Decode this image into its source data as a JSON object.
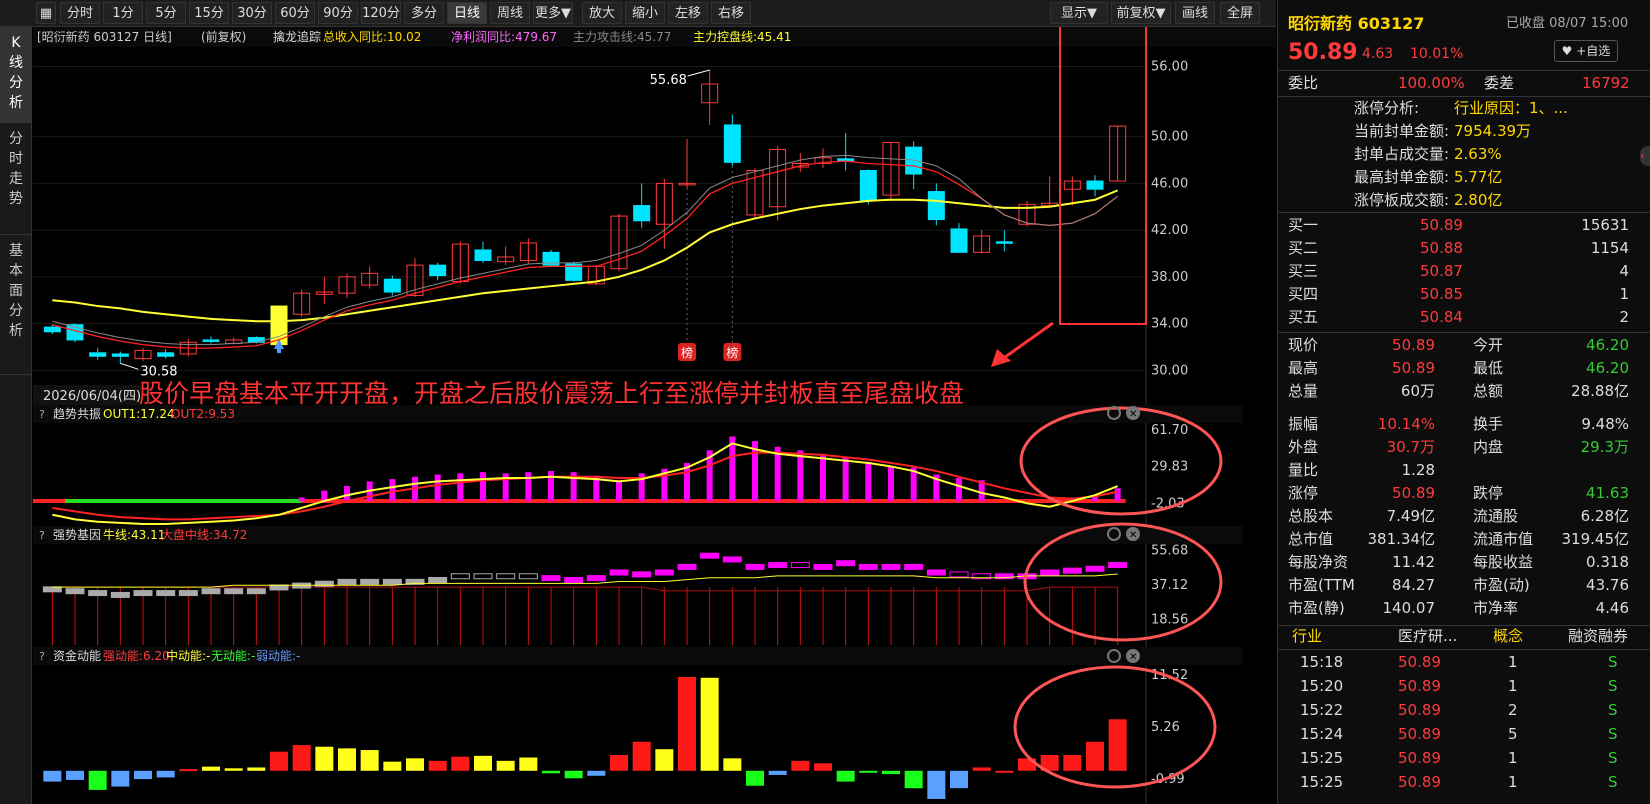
{
  "toolbar": {
    "periods": [
      "分时",
      "1分",
      "5分",
      "15分",
      "30分",
      "60分",
      "90分",
      "120分",
      "多分钟",
      "日线",
      "周线",
      "更多▼"
    ],
    "active_period": "日线",
    "tools": [
      "放大",
      "缩小",
      "左移",
      "右移"
    ],
    "right_tools": [
      "显示▼",
      "前复权▼",
      "画线",
      "全屏"
    ]
  },
  "left_tabs": [
    {
      "label": [
        "K",
        "线",
        "分",
        "析"
      ],
      "active": true
    },
    {
      "label": [
        "分",
        "时",
        "走",
        "势"
      ],
      "active": false
    },
    {
      "label": [
        "基",
        "本",
        "面",
        "分",
        "析"
      ],
      "active": false
    }
  ],
  "main_chart": {
    "header_stock": "[昭衍新药 603127 日线]",
    "header_fq": "(前复权)",
    "indicator_name": "擒龙追踪",
    "ind1": "总收入同比:10.02",
    "ind2": "净利润同比:479.67",
    "ind3": "主力攻击线:45.77",
    "ind4": "主力控盘线:45.41",
    "date_label": "2026/06/04(四)",
    "high_marker": "55.68",
    "low_marker": "30.58",
    "bang_label": "榜",
    "annotation": "股价早盘基本平开开盘，开盘之后股价震荡上行至涨停并封板直至尾盘收盘",
    "hidden_char": "尾",
    "sub_char": "开"
  },
  "chart_data": [
    {
      "type": "candlestick",
      "title": "",
      "y_ticks": [
        "56.00",
        "50.00",
        "46.00",
        "42.00",
        "38.00",
        "34.00",
        "30.00"
      ],
      "ylim": [
        30,
        58
      ],
      "candles": [
        {
          "o": 33.7,
          "c": 33.3,
          "h": 33.9,
          "l": 33.1
        },
        {
          "o": 33.9,
          "c": 32.6,
          "h": 34.0,
          "l": 32.4
        },
        {
          "o": 31.5,
          "c": 31.2,
          "h": 31.9,
          "l": 30.9
        },
        {
          "o": 31.4,
          "c": 31.2,
          "h": 31.6,
          "l": 30.6
        },
        {
          "o": 31.0,
          "c": 31.7,
          "h": 31.9,
          "l": 30.8
        },
        {
          "o": 31.5,
          "c": 31.2,
          "h": 31.8,
          "l": 31.0
        },
        {
          "o": 31.4,
          "c": 32.4,
          "h": 32.7,
          "l": 31.2
        },
        {
          "o": 32.6,
          "c": 32.5,
          "h": 32.9,
          "l": 32.3
        },
        {
          "o": 32.3,
          "c": 32.6,
          "h": 32.8,
          "l": 32.2
        },
        {
          "o": 32.8,
          "c": 32.4,
          "h": 32.9,
          "l": 32.3
        },
        {
          "o": 32.2,
          "c": 35.5,
          "h": 35.5,
          "l": 32.2
        },
        {
          "o": 34.8,
          "c": 36.6,
          "h": 36.9,
          "l": 34.6
        },
        {
          "o": 36.5,
          "c": 36.7,
          "h": 38.0,
          "l": 35.7
        },
        {
          "o": 36.6,
          "c": 38.0,
          "h": 38.3,
          "l": 36.2
        },
        {
          "o": 37.3,
          "c": 38.3,
          "h": 38.9,
          "l": 37.0
        },
        {
          "o": 37.8,
          "c": 36.7,
          "h": 38.1,
          "l": 36.4
        },
        {
          "o": 36.4,
          "c": 39.0,
          "h": 39.6,
          "l": 36.3
        },
        {
          "o": 39.0,
          "c": 38.1,
          "h": 39.2,
          "l": 37.7
        },
        {
          "o": 37.6,
          "c": 40.8,
          "h": 41.0,
          "l": 37.4
        },
        {
          "o": 40.3,
          "c": 39.4,
          "h": 41.0,
          "l": 39.2
        },
        {
          "o": 39.3,
          "c": 39.7,
          "h": 40.6,
          "l": 39.0
        },
        {
          "o": 39.4,
          "c": 40.9,
          "h": 41.3,
          "l": 39.1
        },
        {
          "o": 40.1,
          "c": 39.0,
          "h": 40.3,
          "l": 38.9
        },
        {
          "o": 39.1,
          "c": 37.7,
          "h": 39.3,
          "l": 37.6
        },
        {
          "o": 37.4,
          "c": 38.9,
          "h": 39.0,
          "l": 37.3
        },
        {
          "o": 38.7,
          "c": 43.2,
          "h": 43.4,
          "l": 38.5
        },
        {
          "o": 44.1,
          "c": 42.8,
          "h": 46.0,
          "l": 42.2
        },
        {
          "o": 42.5,
          "c": 46.0,
          "h": 46.4,
          "l": 40.4
        },
        {
          "o": 46.0,
          "c": 46.0,
          "h": 49.8,
          "l": 45.6
        },
        {
          "o": 52.9,
          "c": 54.5,
          "h": 55.7,
          "l": 51.0
        },
        {
          "o": 51.0,
          "c": 47.8,
          "h": 51.9,
          "l": 47.5
        },
        {
          "o": 43.3,
          "c": 47.1,
          "h": 47.3,
          "l": 43.0
        },
        {
          "o": 44.0,
          "c": 48.9,
          "h": 49.2,
          "l": 42.8
        },
        {
          "o": 47.4,
          "c": 47.7,
          "h": 48.6,
          "l": 47.0
        },
        {
          "o": 47.7,
          "c": 48.2,
          "h": 49.0,
          "l": 47.3
        },
        {
          "o": 48.1,
          "c": 47.9,
          "h": 50.3,
          "l": 47.1
        },
        {
          "o": 47.1,
          "c": 44.5,
          "h": 47.2,
          "l": 44.2
        },
        {
          "o": 45.0,
          "c": 49.5,
          "h": 49.5,
          "l": 44.6
        },
        {
          "o": 49.1,
          "c": 46.8,
          "h": 49.6,
          "l": 45.5
        },
        {
          "o": 45.3,
          "c": 42.9,
          "h": 46.0,
          "l": 42.4
        },
        {
          "o": 42.1,
          "c": 40.1,
          "h": 42.6,
          "l": 40.1
        },
        {
          "o": 40.1,
          "c": 41.5,
          "h": 42.0,
          "l": 40.0
        },
        {
          "o": 41.0,
          "c": 40.9,
          "h": 42.0,
          "l": 40.2
        },
        {
          "o": 42.5,
          "c": 44.2,
          "h": 44.5,
          "l": 42.3
        },
        {
          "o": 44.1,
          "c": 44.3,
          "h": 46.6,
          "l": 44.0
        },
        {
          "o": 45.5,
          "c": 46.2,
          "h": 46.6,
          "l": 44.1
        },
        {
          "o": 46.2,
          "c": 45.5,
          "h": 46.7,
          "l": 44.9
        },
        {
          "o": 46.2,
          "c": 50.9,
          "h": 50.9,
          "l": 46.2
        }
      ],
      "ma_red": [
        33.9,
        33.4,
        32.9,
        32.5,
        32.2,
        32.0,
        31.9,
        31.9,
        32.0,
        32.1,
        32.6,
        33.4,
        34.3,
        35.1,
        35.6,
        36.0,
        36.6,
        37.1,
        37.6,
        38.0,
        38.4,
        38.8,
        38.9,
        38.9,
        38.9,
        39.5,
        40.2,
        41.5,
        43.0,
        45.1,
        46.0,
        46.5,
        47.0,
        47.5,
        47.8,
        47.9,
        47.7,
        47.6,
        47.5,
        47.0,
        45.9,
        44.7,
        43.3,
        42.6,
        42.4,
        42.6,
        43.4,
        44.9
      ],
      "ma_yellow": [
        36.0,
        35.8,
        35.5,
        35.3,
        35.0,
        34.8,
        34.6,
        34.4,
        34.3,
        34.2,
        34.2,
        34.3,
        34.5,
        34.8,
        35.1,
        35.4,
        35.7,
        36.0,
        36.3,
        36.6,
        36.8,
        37.0,
        37.2,
        37.4,
        37.6,
        38.0,
        38.6,
        39.4,
        40.5,
        41.8,
        42.5,
        43.0,
        43.4,
        43.8,
        44.1,
        44.3,
        44.5,
        44.6,
        44.6,
        44.5,
        44.3,
        44.1,
        43.9,
        43.9,
        44.0,
        44.3,
        44.6,
        45.4
      ],
      "bang_indices": [
        28,
        30
      ]
    },
    {
      "type": "bar",
      "title": "趋势共振",
      "out1_label": "OUT1:17.24",
      "out2_label": "OUT2:9.53",
      "y_ticks": [
        "61.70",
        "29.83",
        "-2.03"
      ],
      "ylim": [
        -20,
        66
      ],
      "values": [
        0,
        0,
        0,
        0,
        0,
        0,
        0,
        0,
        0,
        0,
        0,
        3,
        9,
        13,
        17,
        19,
        21,
        23,
        24,
        25,
        24,
        25,
        26,
        25,
        22,
        18,
        24,
        28,
        33,
        44,
        56,
        52,
        47,
        44,
        41,
        38,
        34,
        30,
        29,
        23,
        20,
        18,
        0,
        0,
        0,
        0,
        4,
        11
      ],
      "line_yellow": [
        -12,
        -16,
        -18,
        -19,
        -20,
        -20,
        -19,
        -18,
        -17,
        -15,
        -12,
        -6,
        0,
        5,
        9,
        12,
        15,
        17,
        18,
        19,
        20,
        20,
        21,
        20,
        19,
        17,
        19,
        24,
        29,
        38,
        50,
        45,
        41,
        39,
        37,
        35,
        33,
        30,
        26,
        19,
        13,
        7,
        3,
        -2,
        -5,
        0,
        5,
        13
      ],
      "line_red": [
        -6,
        -9,
        -12,
        -14,
        -15,
        -16,
        -16,
        -15,
        -14,
        -13,
        -12,
        -9,
        -5,
        0,
        4,
        8,
        11,
        14,
        16,
        18,
        19,
        20,
        21,
        21,
        21,
        20,
        20,
        22,
        25,
        31,
        39,
        42,
        42,
        41,
        40,
        38,
        36,
        33,
        30,
        26,
        21,
        16,
        11,
        7,
        3,
        2,
        4,
        8
      ]
    },
    {
      "type": "bar",
      "title": "强势基因",
      "bull_label": "牛线:43.11",
      "dp_label": "大盘中线:34.72",
      "y_ticks": [
        "55.68",
        "37.12",
        "18.56"
      ],
      "ylim": [
        5,
        58
      ],
      "values": [
        34,
        33,
        32,
        31,
        32,
        32,
        32,
        33,
        33,
        33,
        35,
        36,
        37,
        38,
        38,
        38,
        38,
        39,
        41,
        41,
        41,
        41,
        40,
        39,
        40,
        43,
        42,
        43,
        46,
        52,
        50,
        46,
        47,
        47,
        46,
        48,
        46,
        46,
        46,
        43,
        42,
        41,
        41,
        41,
        43,
        44,
        45,
        47
      ],
      "yellow_line": [
        36,
        36,
        36,
        36,
        36,
        36,
        36,
        36,
        37,
        37,
        37,
        37,
        37,
        37,
        37,
        37,
        38,
        38,
        38,
        38,
        38,
        38,
        38,
        38,
        38,
        39,
        39,
        39,
        40,
        41,
        41,
        41,
        42,
        42,
        42,
        42,
        42,
        42,
        42,
        41,
        41,
        41,
        41,
        42,
        42,
        42,
        42,
        43
      ]
    },
    {
      "type": "bar",
      "title": "资金动能",
      "strong_label": "强动能:6.20",
      "mid_label": "中动能:-",
      "none_label": "无动能:-",
      "weak_label": "弱动能:-",
      "y_ticks": [
        "11.52",
        "5.26",
        "-0.99"
      ],
      "ylim": [
        -4,
        12.5
      ],
      "values": [
        -1.3,
        -1.1,
        -2.3,
        -1.9,
        -1.0,
        -0.8,
        0.2,
        0.5,
        0.3,
        0.4,
        2.3,
        3.1,
        2.9,
        2.7,
        2.5,
        1.1,
        1.5,
        1.2,
        1.7,
        1.8,
        1.2,
        1.6,
        -0.3,
        -0.9,
        -0.6,
        1.9,
        3.5,
        2.6,
        11.3,
        11.2,
        1.5,
        -1.8,
        -0.5,
        1.2,
        0.9,
        -1.3,
        -0.2,
        -0.4,
        -2.1,
        -3.4,
        -2.1,
        0.4,
        0,
        1.5,
        1.9,
        1.9,
        3.5,
        6.2
      ],
      "colors": [
        "blue",
        "blue",
        "green",
        "blue",
        "blue",
        "blue",
        "red",
        "yellow",
        "yellow",
        "yellow",
        "red",
        "red",
        "yellow",
        "yellow",
        "yellow",
        "yellow",
        "yellow",
        "red",
        "red",
        "yellow",
        "yellow",
        "yellow",
        "green",
        "green",
        "blue",
        "red",
        "red",
        "yellow",
        "red",
        "yellow",
        "yellow",
        "green",
        "blue",
        "red",
        "red",
        "green",
        "green",
        "green",
        "green",
        "blue",
        "blue",
        "red",
        "red",
        "red",
        "red",
        "red",
        "red",
        "red"
      ]
    }
  ],
  "colors": {
    "up": "#ff3b3b",
    "down": "#00e5ff",
    "ma_yellow": "#ffff33",
    "ma_red": "#ff2222",
    "magenta": "#ff00ff",
    "highlight_circle": "#ff5555"
  },
  "right_panel": {
    "name": "昭衍新药 603127",
    "status": "已收盘 08/07 15:00",
    "price": "50.89",
    "change": "4.63",
    "pct": "10.01%",
    "fav_btn": "♥ +自选",
    "webi_label": "委比",
    "webi_val": "100.00%",
    "weicha_label": "委差",
    "weicha_val": "16792",
    "zt_rows": [
      {
        "label": "涨停分析:",
        "val": "行业原因：1、..."
      },
      {
        "label": "当前封单金额:",
        "val": "7954.39万"
      },
      {
        "label": "封单占成交量:",
        "val": "2.63%"
      },
      {
        "label": "最高封单金额:",
        "val": "5.77亿"
      },
      {
        "label": "涨停板成交额:",
        "val": "2.80亿"
      }
    ],
    "bids": [
      {
        "label": "买一",
        "price": "50.89",
        "vol": "15631"
      },
      {
        "label": "买二",
        "price": "50.88",
        "vol": "1154"
      },
      {
        "label": "买三",
        "price": "50.87",
        "vol": "4"
      },
      {
        "label": "买四",
        "price": "50.85",
        "vol": "1"
      },
      {
        "label": "买五",
        "price": "50.84",
        "vol": "2"
      }
    ],
    "stats": [
      {
        "l1": "现价",
        "v1": "50.89",
        "c1": "red",
        "l2": "今开",
        "v2": "46.20",
        "c2": "green"
      },
      {
        "l1": "最高",
        "v1": "50.89",
        "c1": "red",
        "l2": "最低",
        "v2": "46.20",
        "c2": "green"
      },
      {
        "l1": "总量",
        "v1": "60万",
        "c1": "white",
        "l2": "总额",
        "v2": "28.88亿",
        "c2": "white"
      },
      {
        "l1": "振幅",
        "v1": "10.14%",
        "c1": "red",
        "l2": "换手",
        "v2": "9.48%",
        "c2": "white"
      },
      {
        "l1": "外盘",
        "v1": "30.7万",
        "c1": "red",
        "l2": "内盘",
        "v2": "29.3万",
        "c2": "green"
      },
      {
        "l1": "量比",
        "v1": "1.28",
        "c1": "white",
        "l2": "",
        "v2": "",
        "c2": "white"
      },
      {
        "l1": "涨停",
        "v1": "50.89",
        "c1": "red",
        "l2": "跌停",
        "v2": "41.63",
        "c2": "green"
      },
      {
        "l1": "总股本",
        "v1": "7.49亿",
        "c1": "white",
        "l2": "流通股",
        "v2": "6.28亿",
        "c2": "white"
      },
      {
        "l1": "总市值",
        "v1": "381.34亿",
        "c1": "white",
        "l2": "流通市值",
        "v2": "319.45亿",
        "c2": "white"
      },
      {
        "l1": "每股净资",
        "v1": "11.42",
        "c1": "white",
        "l2": "每股收益",
        "v2": "0.318",
        "c2": "white"
      },
      {
        "l1": "市盈(TTM",
        "v1": "84.27",
        "c1": "white",
        "l2": "市盈(动)",
        "v2": "43.76",
        "c2": "white"
      },
      {
        "l1": "市盈(静)",
        "v1": "140.07",
        "c1": "white",
        "l2": "市净率",
        "v2": "4.46",
        "c2": "white"
      }
    ],
    "industry_row": {
      "a": "行业",
      "b": "医疗研...",
      "c": "概念",
      "d": "融资融券"
    },
    "ticks": [
      {
        "t": "15:18",
        "p": "50.89",
        "v": "1",
        "s": "S"
      },
      {
        "t": "15:20",
        "p": "50.89",
        "v": "1",
        "s": "S"
      },
      {
        "t": "15:22",
        "p": "50.89",
        "v": "2",
        "s": "S"
      },
      {
        "t": "15:24",
        "p": "50.89",
        "v": "5",
        "s": "S"
      },
      {
        "t": "15:25",
        "p": "50.89",
        "v": "1",
        "s": "S"
      },
      {
        "t": "15:25",
        "p": "50.89",
        "v": "1",
        "s": "S"
      }
    ]
  }
}
